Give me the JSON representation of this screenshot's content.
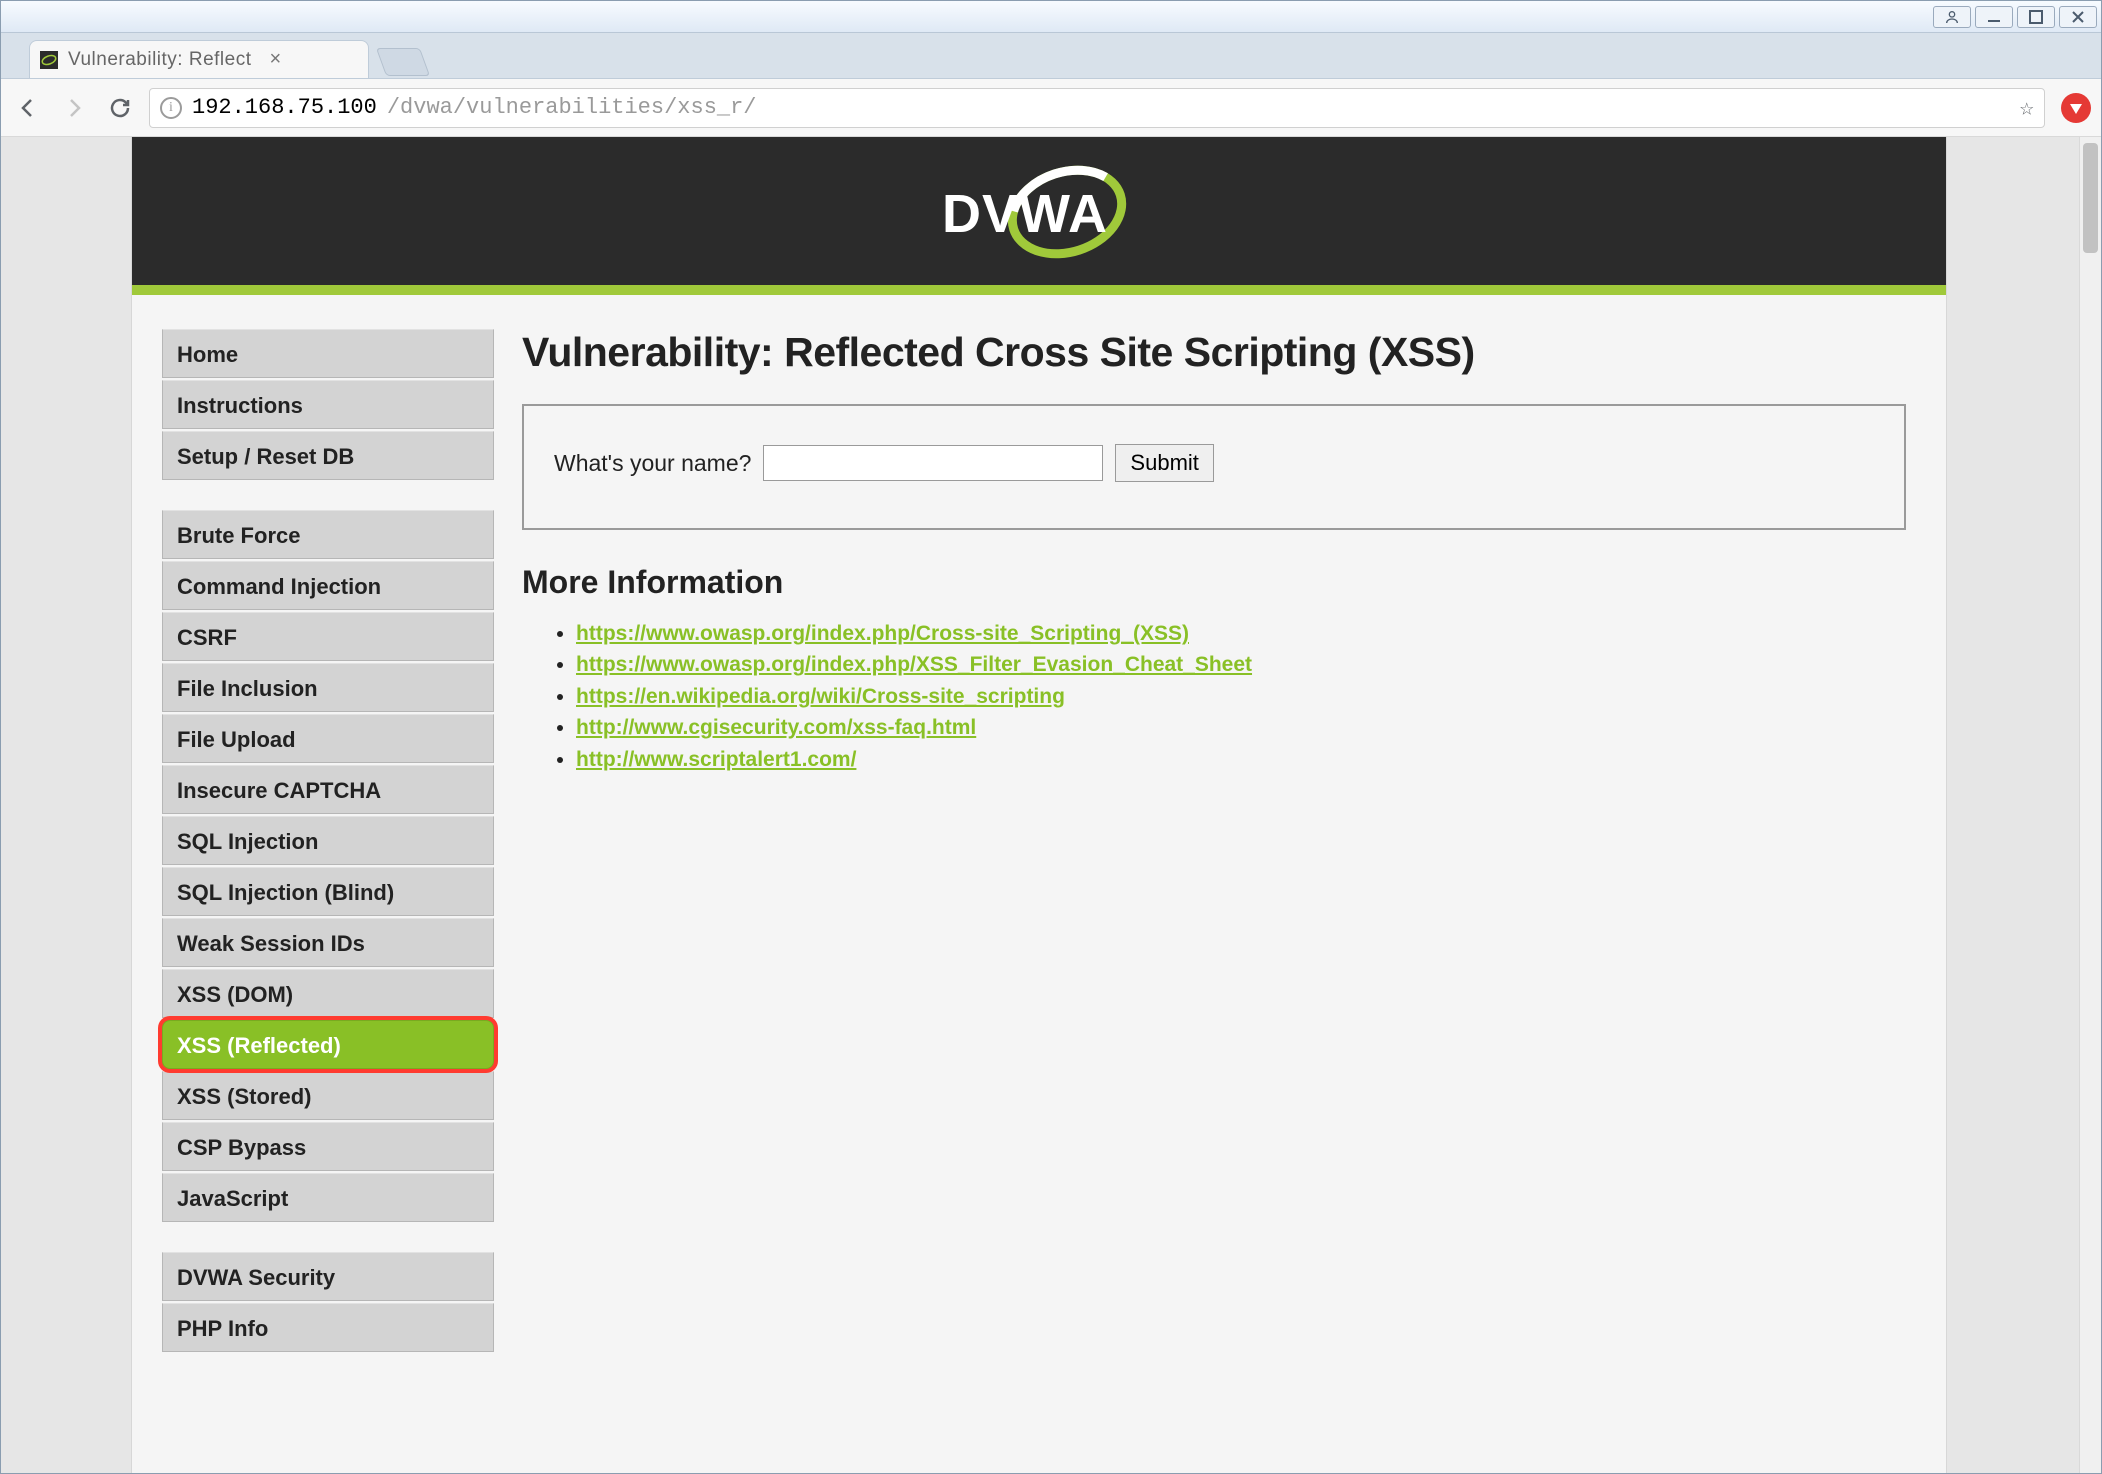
{
  "window": {
    "buttons": {
      "user": "user-icon",
      "min": "min-icon",
      "max": "max-icon",
      "close": "close-icon"
    }
  },
  "browser": {
    "tab_title": "Vulnerability: Reflect",
    "url_host": "192.168.75.100",
    "url_path": "/dvwa/vulnerabilities/xss_r/"
  },
  "header": {
    "logo_text": "DVWA"
  },
  "sidebar": {
    "group1": [
      {
        "label": "Home"
      },
      {
        "label": "Instructions"
      },
      {
        "label": "Setup / Reset DB"
      }
    ],
    "group2": [
      {
        "label": "Brute Force"
      },
      {
        "label": "Command Injection"
      },
      {
        "label": "CSRF"
      },
      {
        "label": "File Inclusion"
      },
      {
        "label": "File Upload"
      },
      {
        "label": "Insecure CAPTCHA"
      },
      {
        "label": "SQL Injection"
      },
      {
        "label": "SQL Injection (Blind)"
      },
      {
        "label": "Weak Session IDs"
      },
      {
        "label": "XSS (DOM)"
      },
      {
        "label": "XSS (Reflected)",
        "active": true,
        "highlighted": true
      },
      {
        "label": "XSS (Stored)"
      },
      {
        "label": "CSP Bypass"
      },
      {
        "label": "JavaScript"
      }
    ],
    "group3": [
      {
        "label": "DVWA Security"
      },
      {
        "label": "PHP Info"
      }
    ]
  },
  "main": {
    "title": "Vulnerability: Reflected Cross Site Scripting (XSS)",
    "form_label": "What's your name?",
    "form_value": "",
    "submit_label": "Submit",
    "more_info_heading": "More Information",
    "links": [
      "https://www.owasp.org/index.php/Cross-site_Scripting_(XSS)",
      "https://www.owasp.org/index.php/XSS_Filter_Evasion_Cheat_Sheet",
      "https://en.wikipedia.org/wiki/Cross-site_scripting",
      "http://www.cgisecurity.com/xss-faq.html",
      "http://www.scriptalert1.com/"
    ]
  }
}
